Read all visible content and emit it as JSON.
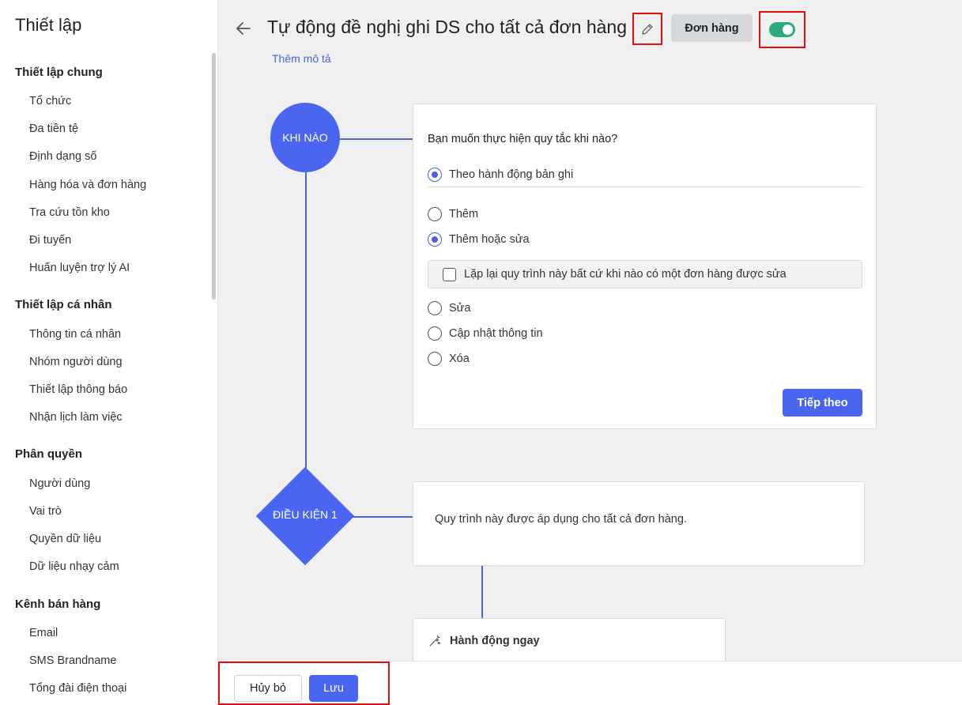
{
  "sidebar": {
    "title": "Thiết lập",
    "groups": [
      {
        "label": "Thiết lập chung",
        "items": [
          "Tổ chức",
          "Đa tiền tệ",
          "Định dạng số",
          "Hàng hóa và đơn hàng",
          "Tra cứu tồn kho",
          "Đi tuyến",
          "Huấn luyện trợ lý AI"
        ]
      },
      {
        "label": "Thiết lập cá nhân",
        "items": [
          "Thông tin cá nhân",
          "Nhóm người dùng",
          "Thiết lập thông báo",
          "Nhận lịch làm việc"
        ]
      },
      {
        "label": "Phân quyền",
        "items": [
          "Người dùng",
          "Vai trò",
          "Quyền dữ liệu",
          "Dữ liệu nhạy cảm"
        ]
      },
      {
        "label": "Kênh bán hàng",
        "items": [
          "Email",
          "SMS Brandname",
          "Tổng đài điện thoại"
        ]
      }
    ]
  },
  "header": {
    "title": "Tự động đề nghị ghi DS cho tất cả đơn hàng",
    "badge": "Đơn hàng",
    "add_description": "Thêm mô tả",
    "enabled": true
  },
  "flow": {
    "when_node": "KHI NÀO",
    "condition_node": "ĐIỀU KIỆN 1"
  },
  "when_card": {
    "question": "Bạn muốn thực hiện quy tắc khi nào?",
    "trigger_option": "Theo hành động bản ghi",
    "options": [
      "Thêm",
      "Thêm hoặc sửa",
      "Sửa",
      "Cập nhật thông tin",
      "Xóa"
    ],
    "selected_option": "Thêm hoặc sửa",
    "repeat_checkbox": "Lặp lại quy trình này bất cứ khi nào có một đơn hàng được sửa",
    "repeat_checked": false,
    "next_button": "Tiếp theo"
  },
  "condition_card": {
    "text": "Quy trình này được áp dụng cho tất cả đơn hàng."
  },
  "action_card": {
    "label": "Hành động ngay"
  },
  "footer": {
    "cancel": "Hủy bỏ",
    "save": "Lưu"
  },
  "colors": {
    "accent": "#4a66f0",
    "toggle_on": "#2bab82",
    "highlight": "#e01010"
  }
}
